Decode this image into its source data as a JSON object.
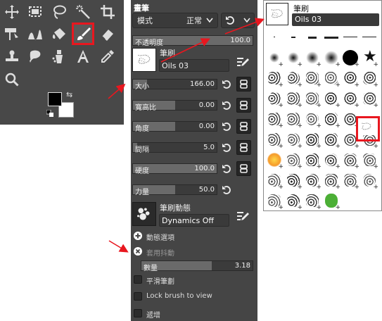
{
  "toolbox": {
    "tools": [
      {
        "name": "move-tool-icon"
      },
      {
        "name": "rect-select-tool-icon"
      },
      {
        "name": "free-select-tool-icon"
      },
      {
        "name": "fuzzy-select-tool-icon"
      },
      {
        "name": "crop-tool-icon"
      },
      {
        "name": "unified-transform-tool-icon"
      },
      {
        "name": "warp-transform-tool-icon"
      },
      {
        "name": "bucket-fill-tool-icon"
      },
      {
        "name": "paintbrush-tool-icon",
        "selected": true
      },
      {
        "name": "eraser-tool-icon"
      },
      {
        "name": "clone-tool-icon"
      },
      {
        "name": "smudge-tool-icon"
      },
      {
        "name": "dodge-burn-tool-icon"
      },
      {
        "name": "text-tool-icon"
      },
      {
        "name": "color-picker-tool-icon"
      },
      {
        "name": "zoom-tool-icon"
      }
    ],
    "fg_color": "#000000",
    "bg_color": "#ffffff",
    "selected_color": "#e8171f"
  },
  "options": {
    "title": "畫筆",
    "mode_label": "模式",
    "mode_value": "正常",
    "opacity_label": "不透明度",
    "opacity_value": "100.0",
    "brush_label": "筆刷",
    "brush_name": "Oils 03",
    "size_label": "大小",
    "size_value": "166.00",
    "size_level": 0.17,
    "aspect_label": "寬高比",
    "aspect_value": "0.00",
    "aspect_level": 0.5,
    "angle_label": "角度",
    "angle_value": "0.00",
    "angle_level": 0.5,
    "spacing_label": "間隔",
    "spacing_value": "5.0",
    "spacing_level": 0.05,
    "hardness_label": "硬度",
    "hardness_value": "100.0",
    "hardness_level": 1.0,
    "force_label": "力量",
    "force_value": "50.0",
    "force_level": 0.5,
    "dynamics_label": "筆刷動態",
    "dynamics_value": "Dynamics Off",
    "dynamics_options_label": "動態選項",
    "jitter_label": "套用抖動",
    "amount_label": "數量",
    "amount_value": "3.18",
    "smooth_label": "平滑筆劃",
    "lock_label": "Lock brush to view",
    "incremental_label": "遞增"
  },
  "popup": {
    "label": "筆刷",
    "brush_name": "Oils 03"
  },
  "colors": {
    "arrow": "#e8171f",
    "panel": "#454545",
    "toolbox": "#484848"
  }
}
